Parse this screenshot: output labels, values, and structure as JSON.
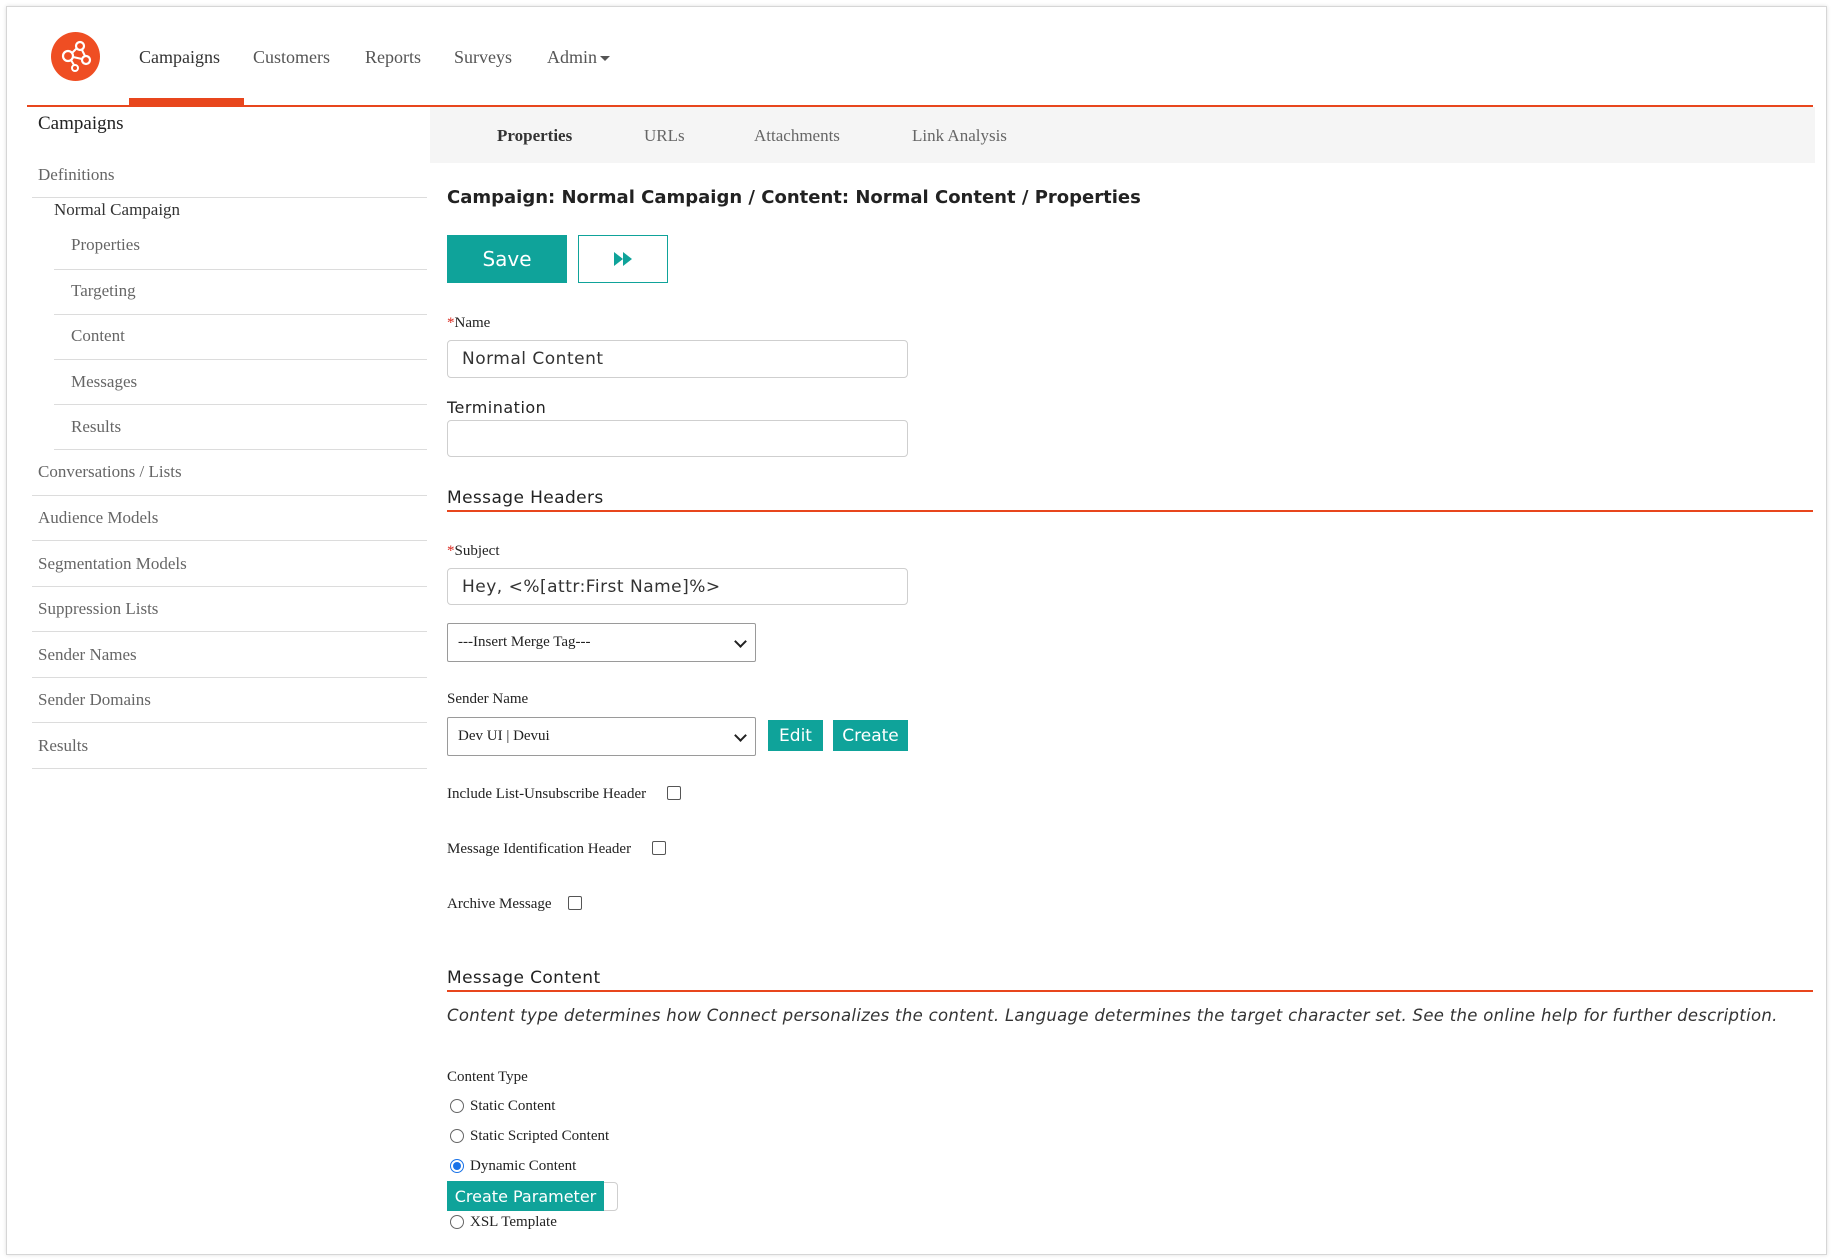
{
  "colors": {
    "accent": "#e8461d",
    "primary_button": "#0fa39a",
    "radio_checked": "#1a73e8"
  },
  "topnav": {
    "logo_icon": "network-hub-logo",
    "items": [
      "Campaigns",
      "Customers",
      "Reports",
      "Surveys",
      "Admin"
    ],
    "active": "Campaigns"
  },
  "sidebar": {
    "title": "Campaigns",
    "definitions": "Definitions",
    "campaign": "Normal Campaign",
    "campaign_items": [
      "Properties",
      "Targeting",
      "Content",
      "Messages",
      "Results"
    ],
    "items": [
      "Conversations / Lists",
      "Audience Models",
      "Segmentation Models",
      "Suppression Lists",
      "Sender Names",
      "Sender Domains",
      "Results"
    ]
  },
  "tabs": {
    "items": [
      "Properties",
      "URLs",
      "Attachments",
      "Link Analysis"
    ],
    "active": "Properties"
  },
  "page_title": "Campaign: Normal Campaign / Content: Normal Content / Properties",
  "actions": {
    "save": "Save",
    "next_icon": "fast-forward-icon"
  },
  "form": {
    "required_mark": "*",
    "name_label": "Name",
    "name_value": "Normal Content",
    "termination_label": "Termination",
    "termination_value": "",
    "message_headers_title": "Message Headers",
    "subject_label": "Subject",
    "subject_value": "Hey, <%[attr:First Name]%>",
    "merge_tag_selected": "---Insert Merge Tag---",
    "sender_name_label": "Sender Name",
    "sender_name_selected": "Dev UI | Devui",
    "edit_label": "Edit",
    "create_label": "Create",
    "include_unsub_label": "Include List-Unsubscribe Header",
    "include_unsub_checked": false,
    "msg_ident_label": "Message Identification Header",
    "msg_ident_checked": false,
    "archive_label": "Archive Message",
    "archive_checked": false,
    "message_content_title": "Message Content",
    "message_content_desc": "Content type determines how Connect personalizes the content. Language determines the target character set. See the online help for further description.",
    "content_type_label": "Content Type",
    "content_types": [
      "Static Content",
      "Static Scripted Content",
      "Dynamic Content",
      "XSL Template"
    ],
    "content_type_selected": "Dynamic Content",
    "create_parameter_label": "Create Parameter"
  }
}
